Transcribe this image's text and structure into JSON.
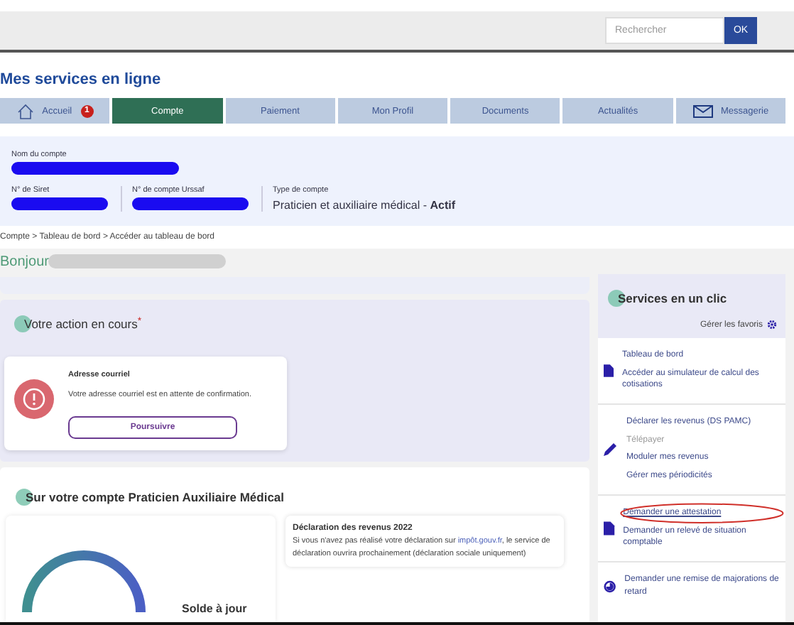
{
  "header": {
    "search": {
      "placeholder": "Rechercher"
    },
    "search_button": "OK"
  },
  "title": "Mes services en ligne",
  "nav": [
    {
      "label": "Accueil",
      "selected": false,
      "badge": "1"
    },
    {
      "label": "Compte",
      "selected": true
    },
    {
      "label": "Paiement",
      "selected": false
    },
    {
      "label": "Mon Profil",
      "selected": false
    },
    {
      "label": "Documents",
      "selected": false
    },
    {
      "label": "Actualités",
      "selected": false
    },
    {
      "label": "Messagerie",
      "selected": false
    }
  ],
  "account": {
    "name_label": "Nom du compte",
    "siret_label": "N° de Siret",
    "urssaf_label": "N° de compte Urssaf",
    "type_label": "Type de compte",
    "type_value": "Praticien et auxiliaire médical - **Actif**"
  },
  "breadcrumb": "Compte > Tableau de bord > Accéder au tableau de bord",
  "greeting": "Bonjour",
  "action": {
    "title": "Votre action en cours",
    "required_mark": "*",
    "card": {
      "title": "Adresse courriel",
      "text": "Votre adresse courriel est en attente de confirmation.",
      "button": "Poursuivre"
    }
  },
  "account_section": {
    "title": "Sur votre compte Praticien Auxiliaire Médical",
    "balance": "Solde à jour",
    "notice": {
      "title": "Déclaration des revenus 2022",
      "text_before": "Si vous n'avez pas réalisé votre déclaration sur ",
      "link": "impôt.gouv.fr",
      "text_after": ", le service de déclaration ouvrira prochainement (déclaration sociale uniquement)"
    }
  },
  "services": {
    "title": "Services en un clic",
    "manage": "Gérer les favoris",
    "groups": [
      {
        "kind": "document",
        "links": [
          {
            "label": "Tableau de bord",
            "disabled": false,
            "circled": false
          },
          {
            "label": "Accéder au simulateur de calcul des cotisations",
            "disabled": false,
            "circled": false
          }
        ]
      },
      {
        "kind": "pencil",
        "links": [
          {
            "label": "Déclarer les revenus (DS PAMC)",
            "disabled": false,
            "circled": false
          },
          {
            "label": "Télépayer",
            "disabled": true,
            "circled": false
          },
          {
            "label": "Moduler mes revenus",
            "disabled": false,
            "circled": false
          },
          {
            "label": "Gérer mes périodicités",
            "disabled": false,
            "circled": false
          }
        ]
      },
      {
        "kind": "document",
        "links": [
          {
            "label": "Demander une attestation",
            "disabled": false,
            "circled": true
          },
          {
            "label": "Demander un relevé de situation comptable",
            "disabled": false,
            "circled": false
          }
        ]
      },
      {
        "kind": "clock",
        "links": [
          {
            "label": "Demander une remise de majorations de retard",
            "disabled": false,
            "circled": false
          }
        ]
      }
    ]
  }
}
